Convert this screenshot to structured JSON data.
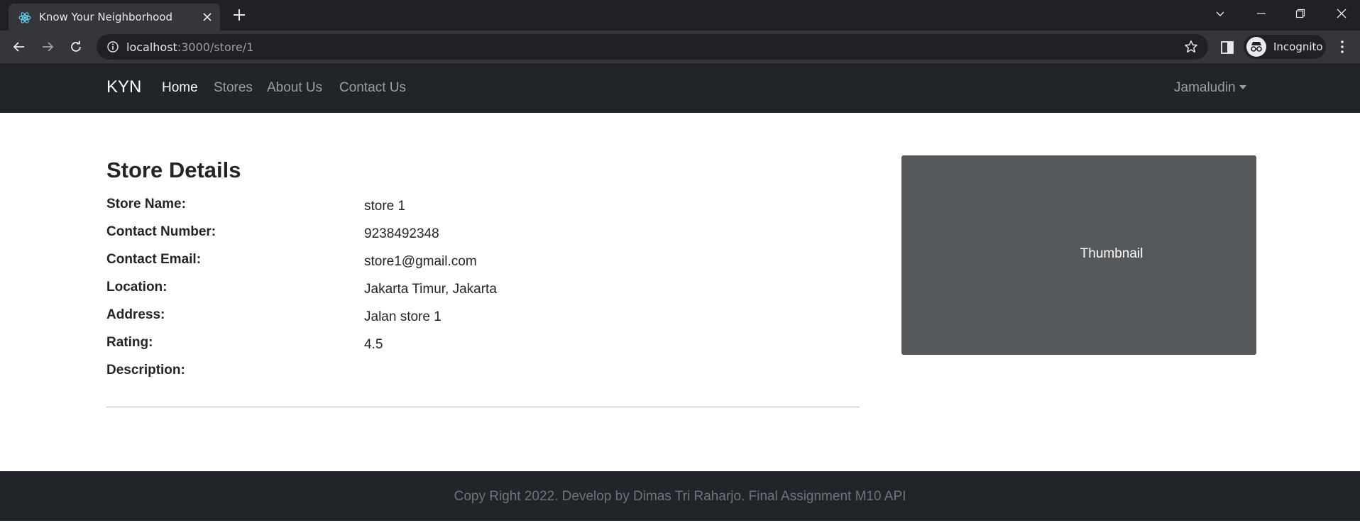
{
  "browser": {
    "tab_title": "Know Your Neighborhood",
    "url_host": "localhost",
    "url_path": ":3000/store/1",
    "profile_label": "Incognito",
    "icons": [
      "react-favicon-icon",
      "tab-close-icon",
      "new-tab-icon",
      "tab-search-icon",
      "minimize-icon",
      "restore-icon",
      "close-window-icon",
      "back-icon",
      "forward-icon",
      "reload-icon",
      "site-info-icon",
      "bookmark-star-icon",
      "side-panel-icon",
      "incognito-icon",
      "kebab-menu-icon"
    ]
  },
  "navbar": {
    "brand": "KYN",
    "links": [
      {
        "label": "Home",
        "active": true
      },
      {
        "label": "Stores",
        "active": false
      },
      {
        "label": "About Us",
        "active": false
      },
      {
        "label": "Contact Us",
        "active": false
      }
    ],
    "user": "Jamaludin"
  },
  "store": {
    "heading": "Store Details",
    "fields": [
      {
        "label": "Store Name:",
        "value": "store 1"
      },
      {
        "label": "Contact Number:",
        "value": "9238492348"
      },
      {
        "label": "Contact Email:",
        "value": "store1@gmail.com"
      },
      {
        "label": "Location:",
        "value": "Jakarta Timur, Jakarta"
      },
      {
        "label": "Address:",
        "value": "Jalan store 1"
      },
      {
        "label": "Rating:",
        "value": "4.5"
      },
      {
        "label": "Description:",
        "value": ""
      }
    ],
    "thumbnail_label": "Thumbnail"
  },
  "footer": {
    "text": "Copy Right 2022. Develop by Dimas Tri Raharjo. Final Assignment M10 API"
  },
  "colors": {
    "navbar_bg": "#212529",
    "thumbnail_bg": "#55595c",
    "chrome_dark": "#202124",
    "chrome_toolbar": "#35363a"
  }
}
